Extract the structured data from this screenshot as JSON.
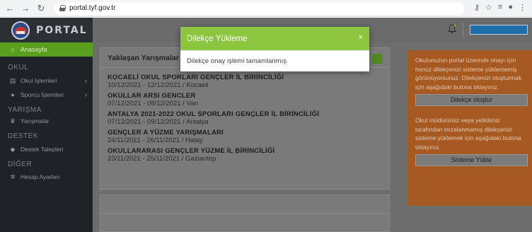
{
  "browser": {
    "url": "portal.tyf.gov.tr"
  },
  "brand": {
    "name": "PORTAL"
  },
  "sidebar": {
    "active": "Anasayfa",
    "sections": [
      {
        "title": "OKUL",
        "items": [
          "Okul İşlemleri",
          "Sporcu İşlemleri"
        ]
      },
      {
        "title": "YARIŞMA",
        "items": [
          "Yarışmalar"
        ]
      },
      {
        "title": "DESTEK",
        "items": [
          "Destek Talepleri"
        ]
      },
      {
        "title": "DİĞER",
        "items": [
          "Hesap Ayarları"
        ]
      }
    ]
  },
  "panel": {
    "title": "Yaklaşan Yarışmalar",
    "competitions": [
      {
        "name": "KOCAELİ OKUL SPORLARI GENÇLER İL BİRİNCİLİĞİ",
        "dates": "10/12/2021 - 12/12/2021",
        "city": "Kocaeli"
      },
      {
        "name": "OKULLAR ARSI GENCLER",
        "dates": "07/12/2021 - 08/12/2021",
        "city": "Van"
      },
      {
        "name": "ANTALYA 2021-2022 OKUL SPORLARI GENÇLER İL BİRİNCİLİĞİ",
        "dates": "07/12/2021 - 09/12/2021",
        "city": "Antalya"
      },
      {
        "name": "GENÇLER A YÜZME YARIŞMALARI",
        "dates": "24/11/2021 - 26/11/2021",
        "city": "Hatay"
      },
      {
        "name": "OKULLARARASI GENÇLER YÜZME İL BİRİNCİLİĞİ",
        "dates": "23/11/2021 - 25/11/2021",
        "city": "Gaziantep"
      }
    ]
  },
  "orange": {
    "text1": "Okulunuzun portal üzerinde onayı için henüz dilekçenizi sisteme yüklememiş görünüyorsunuz. Dilekçenizi oluşturmak için aşağıdaki butona tıklayınız.",
    "button1": "Dilekçe oluştur",
    "text2": "Okul müdürünüz veya yetkilimiz tarafından imzalanmamış dilekçenizi sisteme yüklemek için aşağıdaki butona tıklayınız.",
    "button2": "Sisteme Yükle"
  },
  "modal": {
    "title": "Dilekçe Yükleme",
    "close": "×",
    "message": "Dilekçe onay işlemi tamamlanmış"
  },
  "colors": {
    "accent": "#8cc63f",
    "sidebar": "#1e2326",
    "orange": "#f39530"
  }
}
